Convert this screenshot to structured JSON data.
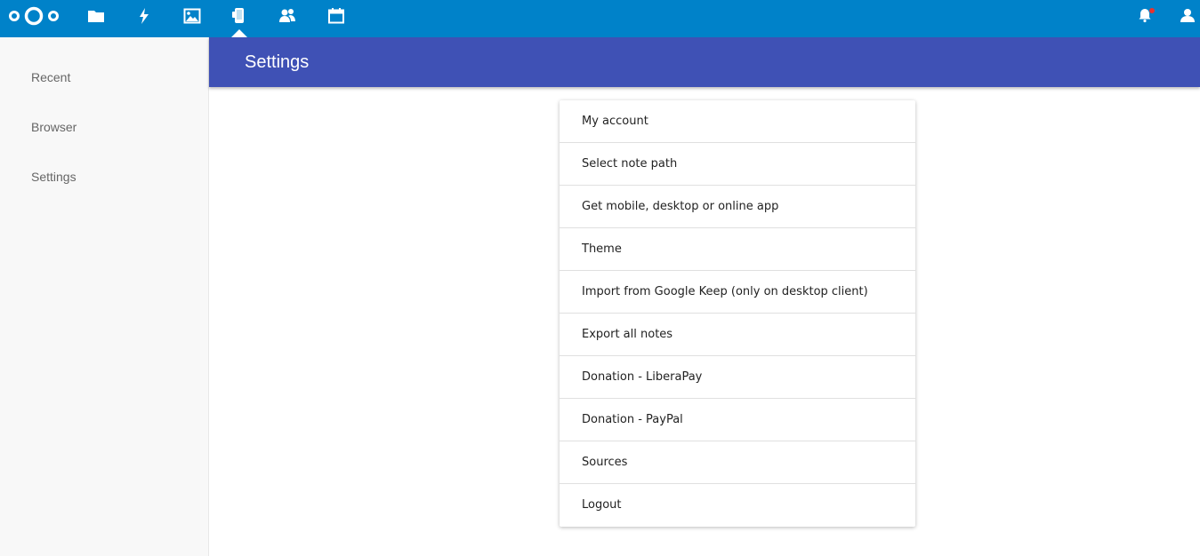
{
  "colors": {
    "topbar": "#0082c9",
    "header": "#3f51b5",
    "notification_dot": "#e9322d",
    "icon": "#ffffff"
  },
  "topbar": {
    "logo_icon": "nextcloud-logo",
    "apps": [
      {
        "icon": "folder-icon"
      },
      {
        "icon": "activity-bolt-icon"
      },
      {
        "icon": "gallery-image-icon"
      },
      {
        "icon": "notes-phone-icon",
        "active": true
      },
      {
        "icon": "contacts-icon"
      },
      {
        "icon": "calendar-icon"
      }
    ],
    "right": [
      {
        "icon": "notification-bell-icon",
        "has_unread": true
      },
      {
        "icon": "user-avatar-icon"
      }
    ]
  },
  "sidebar": {
    "items": [
      {
        "label": "Recent"
      },
      {
        "label": "Browser"
      },
      {
        "label": "Settings"
      }
    ]
  },
  "header": {
    "title": "Settings"
  },
  "settings": {
    "items": [
      {
        "label": "My account"
      },
      {
        "label": "Select note path"
      },
      {
        "label": "Get mobile, desktop or online app"
      },
      {
        "label": "Theme"
      },
      {
        "label": "Import from Google Keep (only on desktop client)"
      },
      {
        "label": "Export all notes"
      },
      {
        "label": "Donation - LiberaPay"
      },
      {
        "label": "Donation - PayPal"
      },
      {
        "label": "Sources"
      },
      {
        "label": "Logout"
      }
    ]
  }
}
